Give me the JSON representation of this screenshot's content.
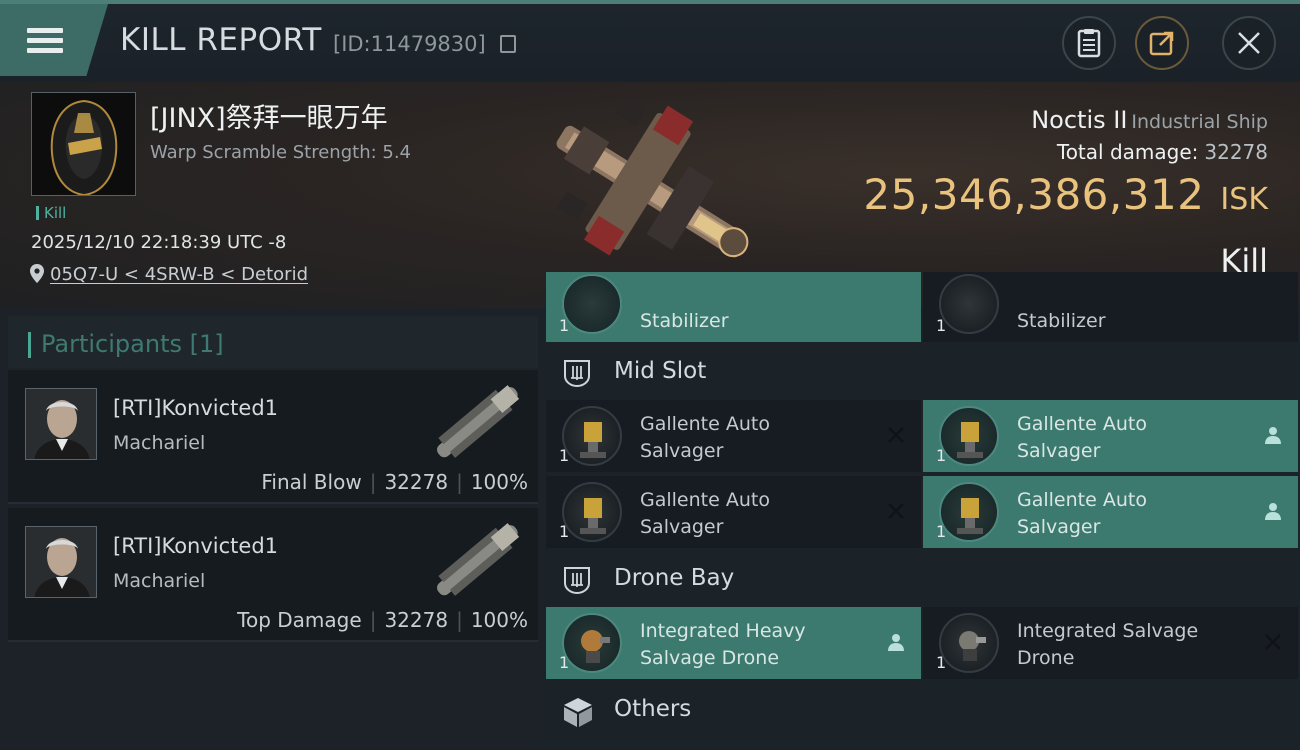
{
  "header": {
    "title": "KILL REPORT",
    "report_id": "[ID:11479830]"
  },
  "victim": {
    "name": "[JINX]祭拜一眼万年",
    "scramble": "Warp Scramble Strength: 5.4",
    "tag": "Kill",
    "datetime": "2025/12/10 22:18:39 UTC -8",
    "location": "05Q7-U < 4SRW-B < Detorid"
  },
  "ship": {
    "name": "Noctis II",
    "class": "Industrial Ship",
    "damage_label": "Total damage:",
    "damage_value": "32278",
    "isk_value": "25,346,386,312",
    "isk_unit": "ISK",
    "result": "Kill"
  },
  "participants": {
    "title": "Participants",
    "count": "[1]",
    "rows": [
      {
        "name": "[RTI]Konvicted1",
        "ship": "Machariel",
        "role": "Final Blow",
        "damage": "32278",
        "percent": "100%"
      },
      {
        "name": "[RTI]Konvicted1",
        "ship": "Machariel",
        "role": "Top Damage",
        "damage": "32278",
        "percent": "100%"
      }
    ]
  },
  "fitting": {
    "top_partial": [
      {
        "qty": "1",
        "name": "Stabilizer"
      },
      {
        "qty": "1",
        "name": "Stabilizer"
      }
    ],
    "sections": {
      "mid": "Mid Slot",
      "drone": "Drone Bay",
      "others": "Others"
    },
    "mid_slot": [
      {
        "qty": "1",
        "line1": "Gallente Auto",
        "line2": "Salvager",
        "status": "destroyed"
      },
      {
        "qty": "1",
        "line1": "Gallente Auto",
        "line2": "Salvager",
        "status": "dropped"
      },
      {
        "qty": "1",
        "line1": "Gallente Auto",
        "line2": "Salvager",
        "status": "destroyed"
      },
      {
        "qty": "1",
        "line1": "Gallente Auto",
        "line2": "Salvager",
        "status": "dropped"
      }
    ],
    "drone_bay": [
      {
        "qty": "1",
        "line1": "Integrated Heavy",
        "line2": "Salvage Drone",
        "status": "dropped"
      },
      {
        "qty": "1",
        "line1": "Integrated Salvage",
        "line2": "Drone",
        "status": "destroyed"
      }
    ]
  },
  "colors": {
    "accent_teal": "#3c7a70",
    "isk_gold": "#e9c27d",
    "panel_bg": "#1c2328"
  },
  "icons": [
    "menu-icon",
    "copy-icon",
    "clipboard-icon",
    "share-icon",
    "close-icon",
    "location-pin-icon",
    "slot-icon",
    "cube-icon",
    "person-icon",
    "x-icon"
  ]
}
